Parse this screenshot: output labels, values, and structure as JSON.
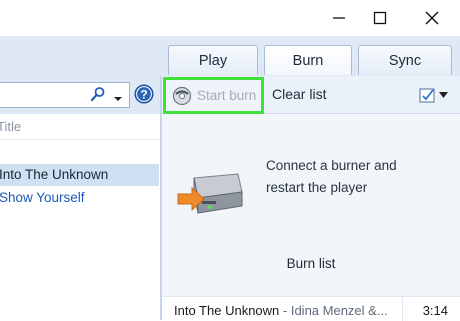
{
  "window": {
    "controls": [
      "minimize-icon",
      "maximize-icon",
      "close-icon"
    ]
  },
  "tabs": [
    {
      "label": "Play"
    },
    {
      "label": "Burn"
    },
    {
      "label": "Sync"
    }
  ],
  "library": {
    "column_header": "Title",
    "tracks": [
      {
        "title": "Into The Unknown"
      },
      {
        "title": "Show Yourself"
      }
    ]
  },
  "burn_toolbar": {
    "start_burn_label": "Start burn",
    "clear_list_label": "Clear list"
  },
  "burn_panel": {
    "message_line1": "Connect a burner and",
    "message_line2": "restart the player",
    "list_title": "Burn list",
    "items": [
      {
        "title": "Into The Unknown",
        "artist": " - Idina Menzel &...",
        "duration": "3:14"
      }
    ]
  },
  "colors": {
    "highlight_border": "#3fe03a",
    "selected_row": "#cfe0f3",
    "link": "#1a5bb8",
    "chrome": "#dfe9f5"
  }
}
